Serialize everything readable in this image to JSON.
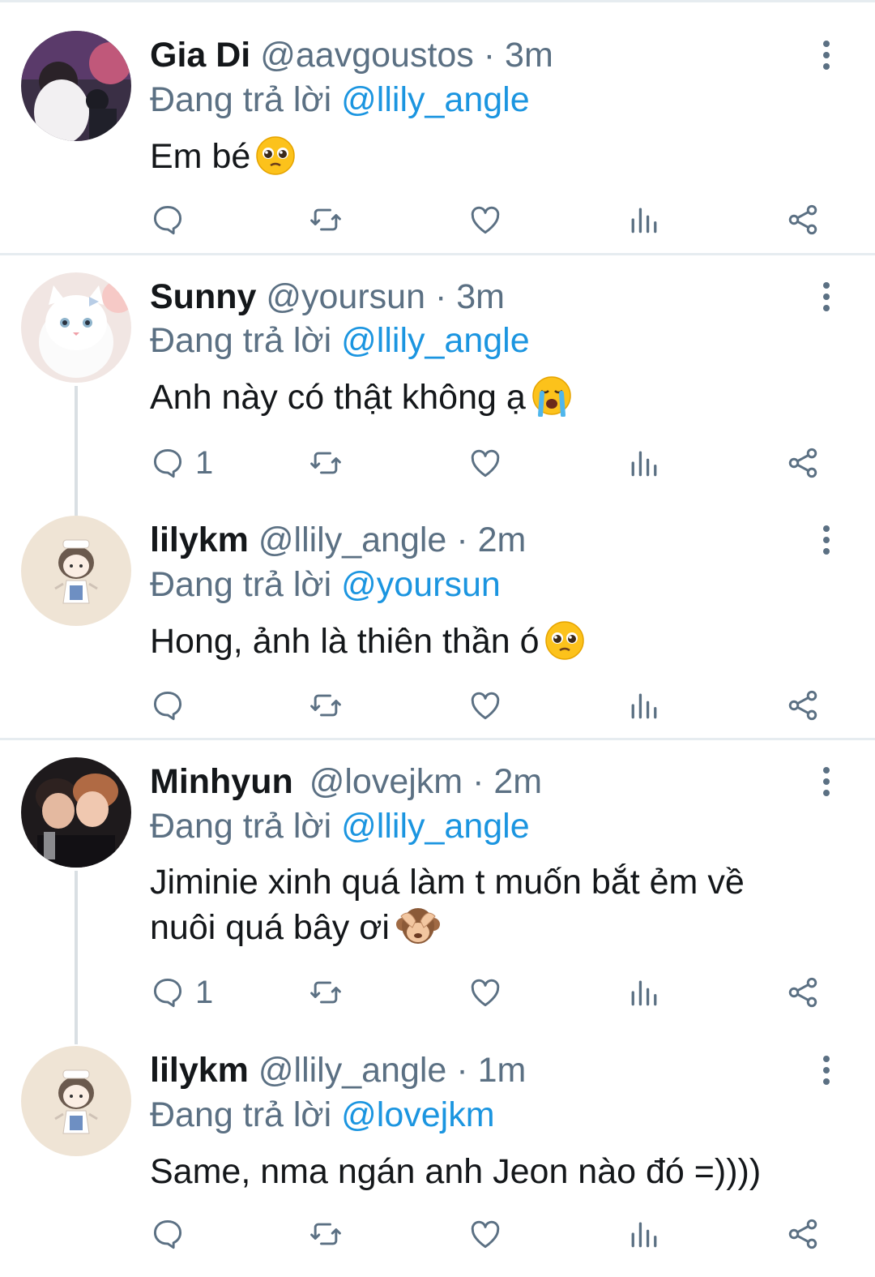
{
  "reply_prefix": "Đang trả lời",
  "tweets": [
    {
      "name": "Gia Di",
      "handle": "@aavgoustos",
      "dot": "·",
      "time": "3m",
      "reply_to": "@llily_angle",
      "text": "Em bé",
      "emoji": "pleading-face",
      "reply_count": ""
    },
    {
      "name": "Sunny",
      "handle": "@yoursun",
      "dot": "·",
      "time": "3m",
      "reply_to": "@llily_angle",
      "text": "Anh này có thật không ạ",
      "emoji": "loudly-crying-face",
      "reply_count": "1"
    },
    {
      "name": "lilykm",
      "handle": "@llily_angle",
      "dot": "·",
      "time": "2m",
      "reply_to": "@yoursun",
      "text": "Hong, ảnh là thiên thần ó",
      "emoji": "pleading-face",
      "reply_count": ""
    },
    {
      "name": "Minhyun",
      "handle": "@lovejkm",
      "dot": "·",
      "time": "2m",
      "reply_to": "@llily_angle",
      "text_line1": "Jiminie xinh quá làm t muốn bắt ẻm về",
      "text_line2": "nuôi quá bây ơi",
      "emoji": "see-no-evil-monkey",
      "reply_count": "1"
    },
    {
      "name": "lilykm",
      "handle": "@llily_angle",
      "dot": "·",
      "time": "1m",
      "reply_to": "@lovejkm",
      "text": "Same, nma ngán anh Jeon nào đó =))))",
      "reply_count": ""
    }
  ],
  "colors": {
    "text": "#14171a",
    "secondary": "#5b7083",
    "mention": "#1b95e0",
    "divider": "#e6ecf0",
    "thread_line": "#d9dfe3"
  },
  "icons": [
    "reply-icon",
    "retweet-icon",
    "like-icon",
    "analytics-icon",
    "share-icon",
    "more-icon"
  ]
}
